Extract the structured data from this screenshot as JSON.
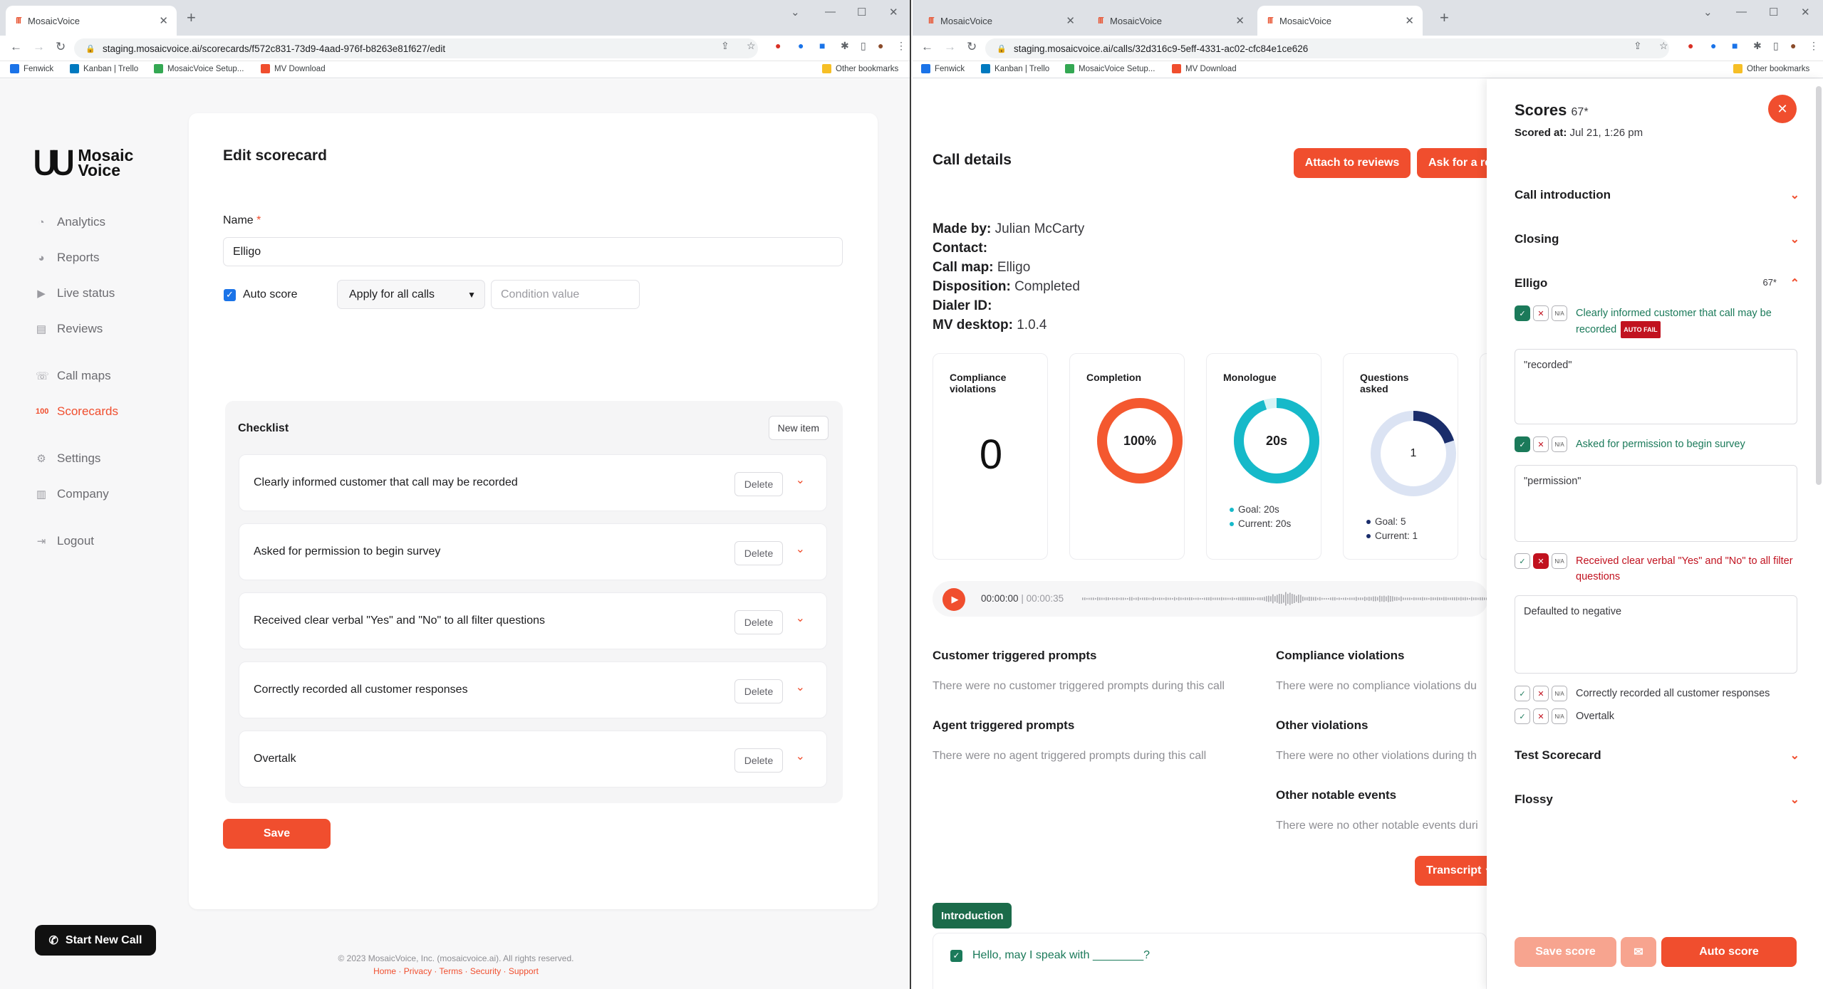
{
  "left": {
    "tab_title": "MosaicVoice",
    "url": "staging.mosaicvoice.ai/scorecards/f572c831-73d9-4aad-976f-b8263e81f627/edit",
    "bookmarks": [
      "Fenwick",
      "Kanban | Trello",
      "MosaicVoice Setup...",
      "MV Download"
    ],
    "other_bookmarks": "Other bookmarks",
    "brand": {
      "line1": "Mosaic",
      "line2": "Voice"
    },
    "sidebar": [
      {
        "label": "Analytics",
        "icon": "pie-chart-icon"
      },
      {
        "label": "Reports",
        "icon": "report-icon"
      },
      {
        "label": "Live status",
        "icon": "play-icon"
      },
      {
        "label": "Reviews",
        "icon": "reviews-icon"
      },
      {
        "label": "Call maps",
        "icon": "call-map-icon"
      },
      {
        "label": "Scorecards",
        "icon": "scorecard-icon",
        "active": true
      },
      {
        "label": "Settings",
        "icon": "gear-icon"
      },
      {
        "label": "Company",
        "icon": "building-icon"
      },
      {
        "label": "Logout",
        "icon": "logout-icon"
      }
    ],
    "start_new_call": "Start New Call",
    "edit": {
      "title": "Edit scorecard",
      "name_label": "Name",
      "required_mark": "*",
      "name_value": "Elligo",
      "auto_score_label": "Auto score",
      "apply_select": "Apply for all calls",
      "condition_placeholder": "Condition value",
      "checklist_title": "Checklist",
      "new_item": "New item",
      "delete_label": "Delete",
      "items": [
        "Clearly informed customer that call may be recorded",
        "Asked for permission to begin survey",
        "Received clear verbal \"Yes\" and \"No\" to all filter questions",
        "Correctly recorded all customer responses",
        "Overtalk"
      ],
      "save": "Save"
    },
    "footer": {
      "copyright": "© 2023 MosaicVoice, Inc. (mosaicvoice.ai). All rights reserved.",
      "links": "Home · Privacy · Terms · Security · Support"
    }
  },
  "right": {
    "tabs": [
      "MosaicVoice",
      "MosaicVoice",
      "MosaicVoice"
    ],
    "url": "staging.mosaicvoice.ai/calls/32d316c9-5eff-4331-ac02-cfc84e1ce626",
    "bookmarks": [
      "Fenwick",
      "Kanban | Trello",
      "MosaicVoice Setup...",
      "MV Download"
    ],
    "other_bookmarks": "Other bookmarks",
    "title": "Call details",
    "attach": "Attach to reviews",
    "ask": "Ask for a re",
    "meta": [
      {
        "k": "Made by:",
        "v": "Julian McCarty"
      },
      {
        "k": "Contact:",
        "v": ""
      },
      {
        "k": "Call map:",
        "v": "Elligo"
      },
      {
        "k": "Disposition:",
        "v": "Completed"
      },
      {
        "k": "Dialer ID:",
        "v": ""
      },
      {
        "k": "MV desktop:",
        "v": "1.0.4"
      }
    ],
    "stats": {
      "compliance": {
        "title": "Compliance violations",
        "value": "0"
      },
      "completion": {
        "title": "Completion",
        "value": "100%",
        "fraction": 1.0
      },
      "monologue": {
        "title": "Monologue",
        "value": "20s",
        "goal": "Goal: 20s",
        "current": "Current: 20s",
        "fraction": 0.95
      },
      "questions": {
        "title": "Questions asked",
        "value": "1",
        "goal": "Goal: 5",
        "current": "Current: 1",
        "fraction": 0.2
      }
    },
    "player": {
      "time": "00:00:00",
      "duration": "00:00:35"
    },
    "sections": [
      {
        "title": "Customer triggered prompts",
        "desc": "There were no customer triggered prompts during this call"
      },
      {
        "title": "Compliance violations",
        "desc": "There were no compliance violations du"
      },
      {
        "title": "Agent triggered prompts",
        "desc": "There were no agent triggered prompts during this call"
      },
      {
        "title": "Other violations",
        "desc": "There were no other violations during th"
      },
      {
        "title": "Other notable events",
        "desc": "There were no other notable events duri"
      }
    ],
    "transcript": "Transcript",
    "intro_tag": "Introduction",
    "intro_line": "Hello, may I speak with ________?",
    "scores": {
      "title": "Scores",
      "score": "67*",
      "scored_at_label": "Scored at:",
      "scored_at": "Jul 21, 1:26 pm",
      "groups": [
        "Call introduction",
        "Closing"
      ],
      "elligo": {
        "name": "Elligo",
        "score": "67*",
        "items": [
          {
            "text": "Clearly informed customer that call may be recorded",
            "state": "yes",
            "badge": "AUTO FAIL",
            "note": "\"recorded\""
          },
          {
            "text": "Asked for permission to begin survey",
            "state": "yes",
            "note": "\"permission\""
          },
          {
            "text": "Received clear verbal \"Yes\" and \"No\" to all filter questions",
            "state": "no",
            "note": "Defaulted to negative"
          },
          {
            "text": "Correctly recorded all customer responses",
            "state": "none"
          },
          {
            "text": "Overtalk",
            "state": "none"
          }
        ]
      },
      "groups_after": [
        "Test Scorecard",
        "Flossy"
      ],
      "na": "N/A",
      "save_score": "Save score",
      "auto_score": "Auto score"
    }
  }
}
